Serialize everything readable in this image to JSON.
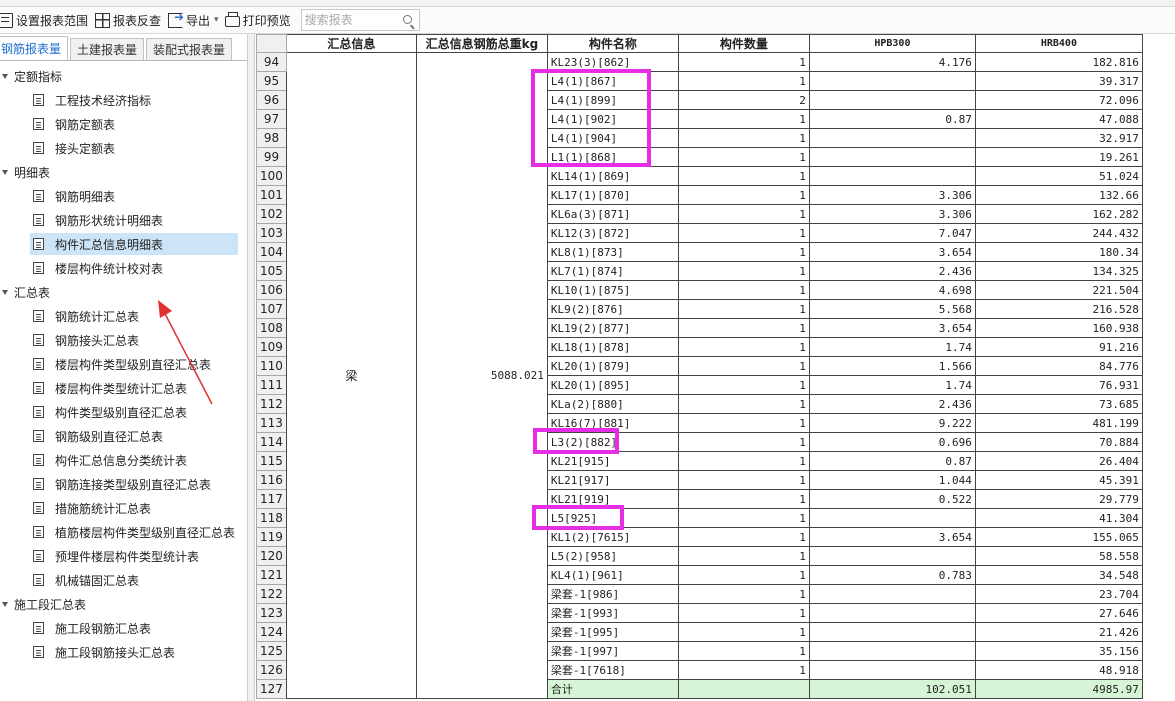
{
  "toolbar": {
    "set_range": "设置报表范围",
    "reverse": "报表反查",
    "export": "导出",
    "print_preview": "打印预览",
    "search_placeholder": "搜索报表"
  },
  "tabs": [
    {
      "label": "钢筋报表量",
      "active": true
    },
    {
      "label": "土建报表量",
      "active": false
    },
    {
      "label": "装配式报表量",
      "active": false
    }
  ],
  "tree": [
    {
      "group": "定额指标",
      "items": [
        "工程技术经济指标",
        "钢筋定额表",
        "接头定额表"
      ]
    },
    {
      "group": "明细表",
      "items": [
        "钢筋明细表",
        "钢筋形状统计明细表",
        "构件汇总信息明细表",
        "楼层构件统计校对表"
      ]
    },
    {
      "group": "汇总表",
      "items": [
        "钢筋统计汇总表",
        "钢筋接头汇总表",
        "楼层构件类型级别直径汇总表",
        "楼层构件类型统计汇总表",
        "构件类型级别直径汇总表",
        "钢筋级别直径汇总表",
        "构件汇总信息分类统计表",
        "钢筋连接类型级别直径汇总表",
        "措施筋统计汇总表",
        "植筋楼层构件类型级别直径汇总表",
        "预埋件楼层构件类型统计表",
        "机械锚固汇总表"
      ]
    },
    {
      "group": "施工段汇总表",
      "items": [
        "施工段钢筋汇总表",
        "施工段钢筋接头汇总表"
      ]
    }
  ],
  "selected_item": "构件汇总信息明细表",
  "table": {
    "headers": [
      "汇总信息",
      "汇总信息钢筋总重kg",
      "构件名称",
      "构件数量",
      "HPB300",
      "HRB400"
    ],
    "merged_info": "梁",
    "merged_weight": "5088.021",
    "rows": [
      [
        "94",
        "KL23(3)[862]",
        "1",
        "4.176",
        "182.816"
      ],
      [
        "95",
        "L4(1)[867]",
        "1",
        "",
        "39.317"
      ],
      [
        "96",
        "L4(1)[899]",
        "2",
        "",
        "72.096"
      ],
      [
        "97",
        "L4(1)[902]",
        "1",
        "0.87",
        "47.088"
      ],
      [
        "98",
        "L4(1)[904]",
        "1",
        "",
        "32.917"
      ],
      [
        "99",
        "L1(1)[868]",
        "1",
        "",
        "19.261"
      ],
      [
        "100",
        "KL14(1)[869]",
        "1",
        "",
        "51.024"
      ],
      [
        "101",
        "KL17(1)[870]",
        "1",
        "3.306",
        "132.66"
      ],
      [
        "102",
        "KL6a(3)[871]",
        "1",
        "3.306",
        "162.282"
      ],
      [
        "103",
        "KL12(3)[872]",
        "1",
        "7.047",
        "244.432"
      ],
      [
        "104",
        "KL8(1)[873]",
        "1",
        "3.654",
        "180.34"
      ],
      [
        "105",
        "KL7(1)[874]",
        "1",
        "2.436",
        "134.325"
      ],
      [
        "106",
        "KL10(1)[875]",
        "1",
        "4.698",
        "221.504"
      ],
      [
        "107",
        "KL9(2)[876]",
        "1",
        "5.568",
        "216.528"
      ],
      [
        "108",
        "KL19(2)[877]",
        "1",
        "3.654",
        "160.938"
      ],
      [
        "109",
        "KL18(1)[878]",
        "1",
        "1.74",
        "91.216"
      ],
      [
        "110",
        "KL20(1)[879]",
        "1",
        "1.566",
        "84.776"
      ],
      [
        "111",
        "KL20(1)[895]",
        "1",
        "1.74",
        "76.931"
      ],
      [
        "112",
        "KLa(2)[880]",
        "1",
        "2.436",
        "73.685"
      ],
      [
        "113",
        "KL16(7)[881]",
        "1",
        "9.222",
        "481.199"
      ],
      [
        "114",
        "L3(2)[882]",
        "1",
        "0.696",
        "70.884"
      ],
      [
        "115",
        "KL21[915]",
        "1",
        "0.87",
        "26.404"
      ],
      [
        "116",
        "KL21[917]",
        "1",
        "1.044",
        "45.391"
      ],
      [
        "117",
        "KL21[919]",
        "1",
        "0.522",
        "29.779"
      ],
      [
        "118",
        "L5[925]",
        "1",
        "",
        "41.304"
      ],
      [
        "119",
        "KL1(2)[7615]",
        "1",
        "3.654",
        "155.065"
      ],
      [
        "120",
        "L5(2)[958]",
        "1",
        "",
        "58.558"
      ],
      [
        "121",
        "KL4(1)[961]",
        "1",
        "0.783",
        "34.548"
      ],
      [
        "122",
        "梁套-1[986]",
        "1",
        "",
        "23.704"
      ],
      [
        "123",
        "梁套-1[993]",
        "1",
        "",
        "27.646"
      ],
      [
        "124",
        "梁套-1[995]",
        "1",
        "",
        "21.426"
      ],
      [
        "125",
        "梁套-1[997]",
        "1",
        "",
        "35.156"
      ],
      [
        "126",
        "梁套-1[7618]",
        "1",
        "",
        "48.918"
      ]
    ],
    "total": {
      "row": "127",
      "label": "合计",
      "hpb300": "102.051",
      "hrb400": "4985.97"
    }
  },
  "colors": {
    "highlight": "#e62ee6",
    "arrow": "#e03030",
    "total_row": "#d6f5d6",
    "selected": "#cce4f7",
    "tab_active": "#1f6fd1"
  }
}
